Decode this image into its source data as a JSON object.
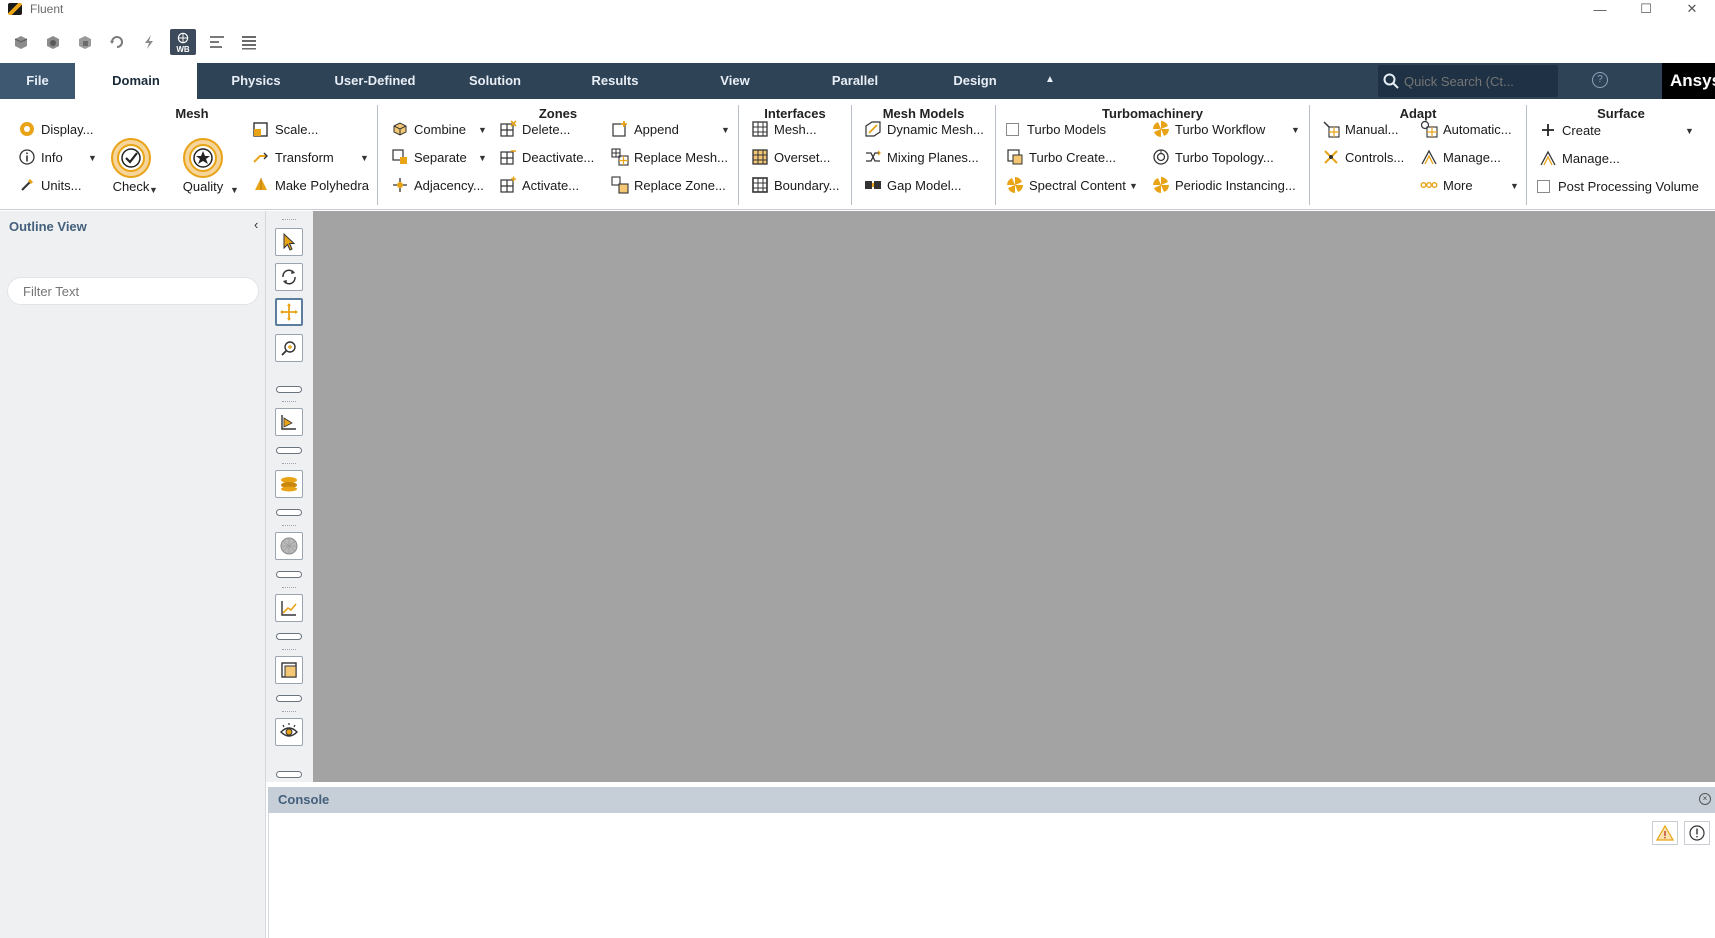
{
  "window": {
    "title": "Fluent",
    "minimize": "—",
    "maximize": "☐",
    "close": "✕"
  },
  "qat": {
    "wb_label": "WB"
  },
  "tabs": {
    "file": "File",
    "domain": "Domain",
    "physics": "Physics",
    "user_defined": "User-Defined",
    "solution": "Solution",
    "results": "Results",
    "view": "View",
    "parallel": "Parallel",
    "design": "Design",
    "collapse": "▲"
  },
  "search": {
    "placeholder": "Quick Search (Ct..."
  },
  "help": "?",
  "brand": "Ansys",
  "ribbon": {
    "mesh": {
      "title": "Mesh",
      "display": "Display...",
      "info": "Info",
      "units": "Units...",
      "check": "Check",
      "quality": "Quality",
      "scale": "Scale...",
      "transform": "Transform",
      "make_polyhedra": "Make Polyhedra"
    },
    "zones": {
      "title": "Zones",
      "combine": "Combine",
      "separate": "Separate",
      "adjacency": "Adjacency...",
      "delete": "Delete...",
      "deactivate": "Deactivate...",
      "activate": "Activate...",
      "append": "Append",
      "replace_mesh": "Replace Mesh...",
      "replace_zone": "Replace Zone..."
    },
    "interfaces": {
      "title": "Interfaces",
      "mesh": "Mesh...",
      "overset": "Overset...",
      "boundary": "Boundary..."
    },
    "mesh_models": {
      "title": "Mesh Models",
      "dynamic_mesh": "Dynamic Mesh...",
      "mixing_planes": "Mixing Planes...",
      "gap_model": "Gap Model..."
    },
    "turbo": {
      "title": "Turbomachinery",
      "turbo_models": "Turbo Models",
      "turbo_create": "Turbo Create...",
      "spectral_content": "Spectral Content",
      "turbo_workflow": "Turbo Workflow",
      "turbo_topology": "Turbo Topology...",
      "periodic_instancing": "Periodic Instancing..."
    },
    "adapt": {
      "title": "Adapt",
      "manual": "Manual...",
      "controls": "Controls...",
      "automatic": "Automatic...",
      "manage": "Manage...",
      "more": "More"
    },
    "surface": {
      "title": "Surface",
      "create": "Create",
      "manage": "Manage...",
      "post_processing_volume": "Post Processing Volume"
    }
  },
  "outline": {
    "title": "Outline View",
    "collapse": "‹",
    "filter_placeholder": "Filter Text"
  },
  "console": {
    "title": "Console",
    "close": "×"
  },
  "colors": {
    "tabbar": "#2f4357",
    "graphics_bg": "#a3a3a3",
    "accent_orange": "#e8a317",
    "panel_bg": "#eef0f2"
  }
}
